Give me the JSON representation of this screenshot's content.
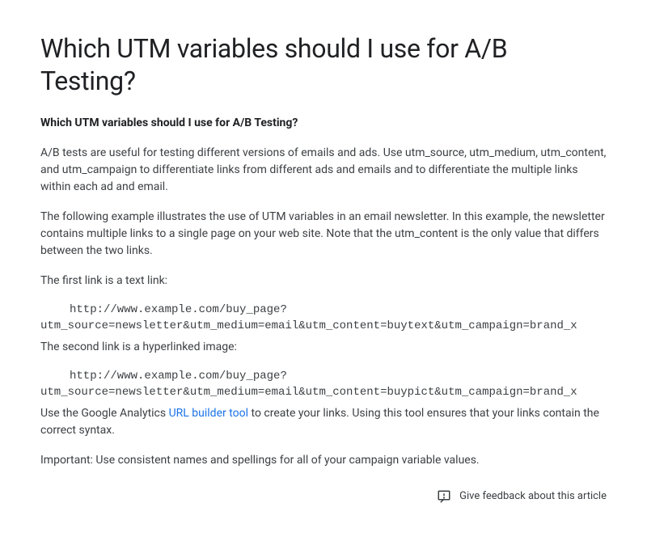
{
  "title": "Which UTM variables should I use for A/B Testing?",
  "subheading": "Which UTM variables should I use for A/B Testing?",
  "para1": "A/B tests are useful for testing different versions of emails and ads. Use utm_source, utm_medium, utm_content, and utm_campaign to differentiate links from different ads and emails and to differentiate the multiple links within each ad and email.",
  "para2": "The following example illustrates the use of UTM variables in an email newsletter. In this example, the newsletter contains multiple links to a single page on your web site. Note that the utm_content is the only value that differs between the two links.",
  "para3": "The first link is a text link:",
  "code1_line1": "http://www.example.com/buy_page?",
  "code1_line2": "utm_source=newsletter&utm_medium=email&utm_content=buytext&utm_campaign=brand_x",
  "para4": "The second link is a hyperlinked image:",
  "code2_line1": "http://www.example.com/buy_page?",
  "code2_line2": "utm_source=newsletter&utm_medium=email&utm_content=buypict&utm_campaign=brand_x",
  "para5_before": "Use the Google Analytics ",
  "para5_link": "URL builder tool",
  "para5_after": " to create your links. Using this tool ensures that your links contain the correct syntax.",
  "para6": "Important: Use consistent names and spellings for all of your campaign variable values.",
  "feedback_label": "Give feedback about this article"
}
